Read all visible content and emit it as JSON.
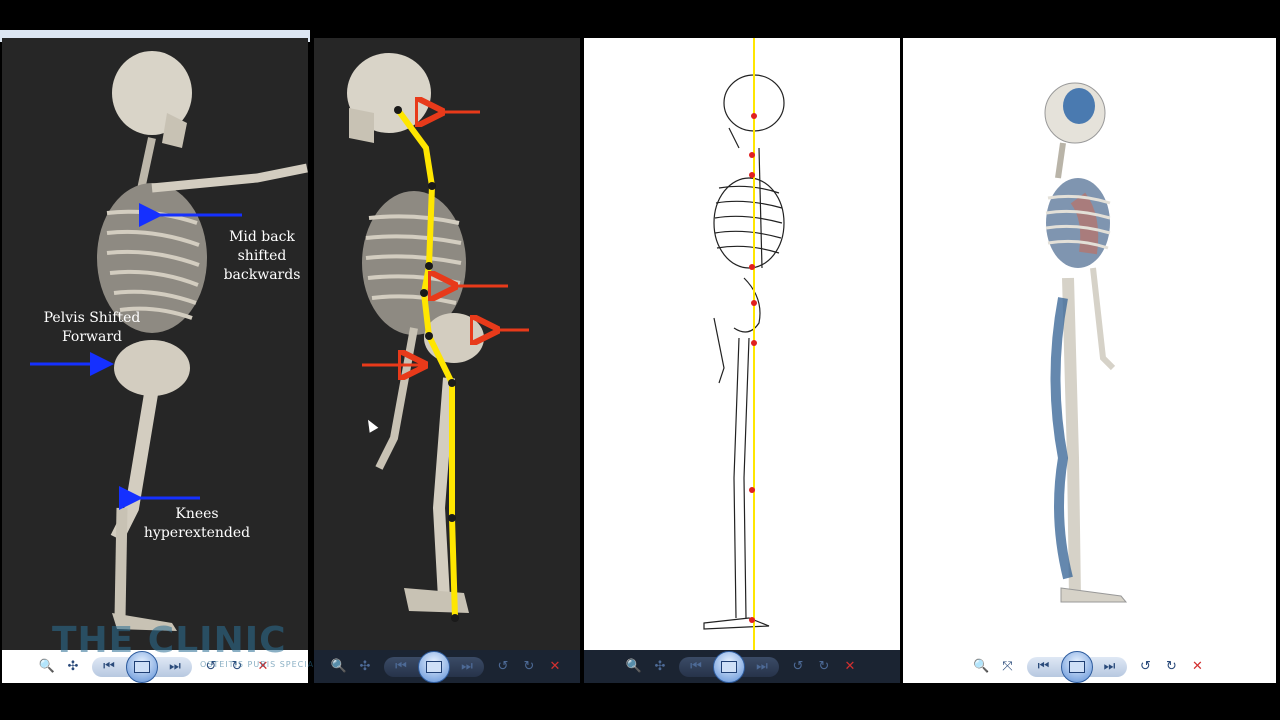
{
  "panel1": {
    "labels": {
      "mid_back": "Mid back\nshifted\nbackwards",
      "pelvis": "Pelvis Shifted\nForward",
      "knees": "Knees\nhyperextended"
    },
    "watermark": "THE CLINIC",
    "watermark_sub": "OSTEITIS PUBIS SPECIALISTS"
  },
  "toolbar_icons": [
    "zoom-icon",
    "fit-icon",
    "previous-icon",
    "slideshow-icon",
    "next-icon",
    "rotate-left-icon",
    "rotate-right-icon",
    "delete-icon"
  ],
  "colors": {
    "arrow_blue": "#1530ff",
    "arrow_red": "#e83a1a",
    "plumb_line": "#ffe600",
    "marker": "#e02020"
  }
}
